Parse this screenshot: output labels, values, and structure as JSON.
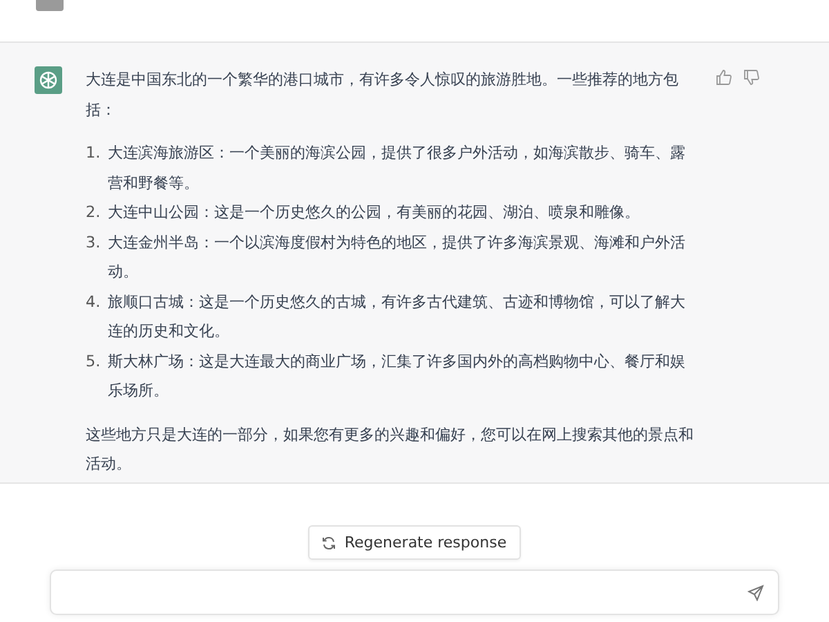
{
  "response": {
    "intro": "大连是中国东北的一个繁华的港口城市，有许多令人惊叹的旅游胜地。一些推荐的地方包括：",
    "items": [
      {
        "number": "1.",
        "text": "大连滨海旅游区：一个美丽的海滨公园，提供了很多户外活动，如海滨散步、骑车、露营和野餐等。"
      },
      {
        "number": "2.",
        "text": "大连中山公园：这是一个历史悠久的公园，有美丽的花园、湖泊、喷泉和雕像。"
      },
      {
        "number": "3.",
        "text": "大连金州半岛：一个以滨海度假村为特色的地区，提供了许多海滨景观、海滩和户外活动。"
      },
      {
        "number": "4.",
        "text": "旅顺口古城：这是一个历史悠久的古城，有许多古代建筑、古迹和博物馆，可以了解大连的历史和文化。"
      },
      {
        "number": "5.",
        "text": "斯大林广场：这是大连最大的商业广场，汇集了许多国内外的高档购物中心、餐厅和娱乐场所。"
      }
    ],
    "closing": "这些地方只是大连的一部分，如果您有更多的兴趣和偏好，您可以在网上搜索其他的景点和活动。"
  },
  "regenerate_button": {
    "label": "Regenerate response"
  }
}
